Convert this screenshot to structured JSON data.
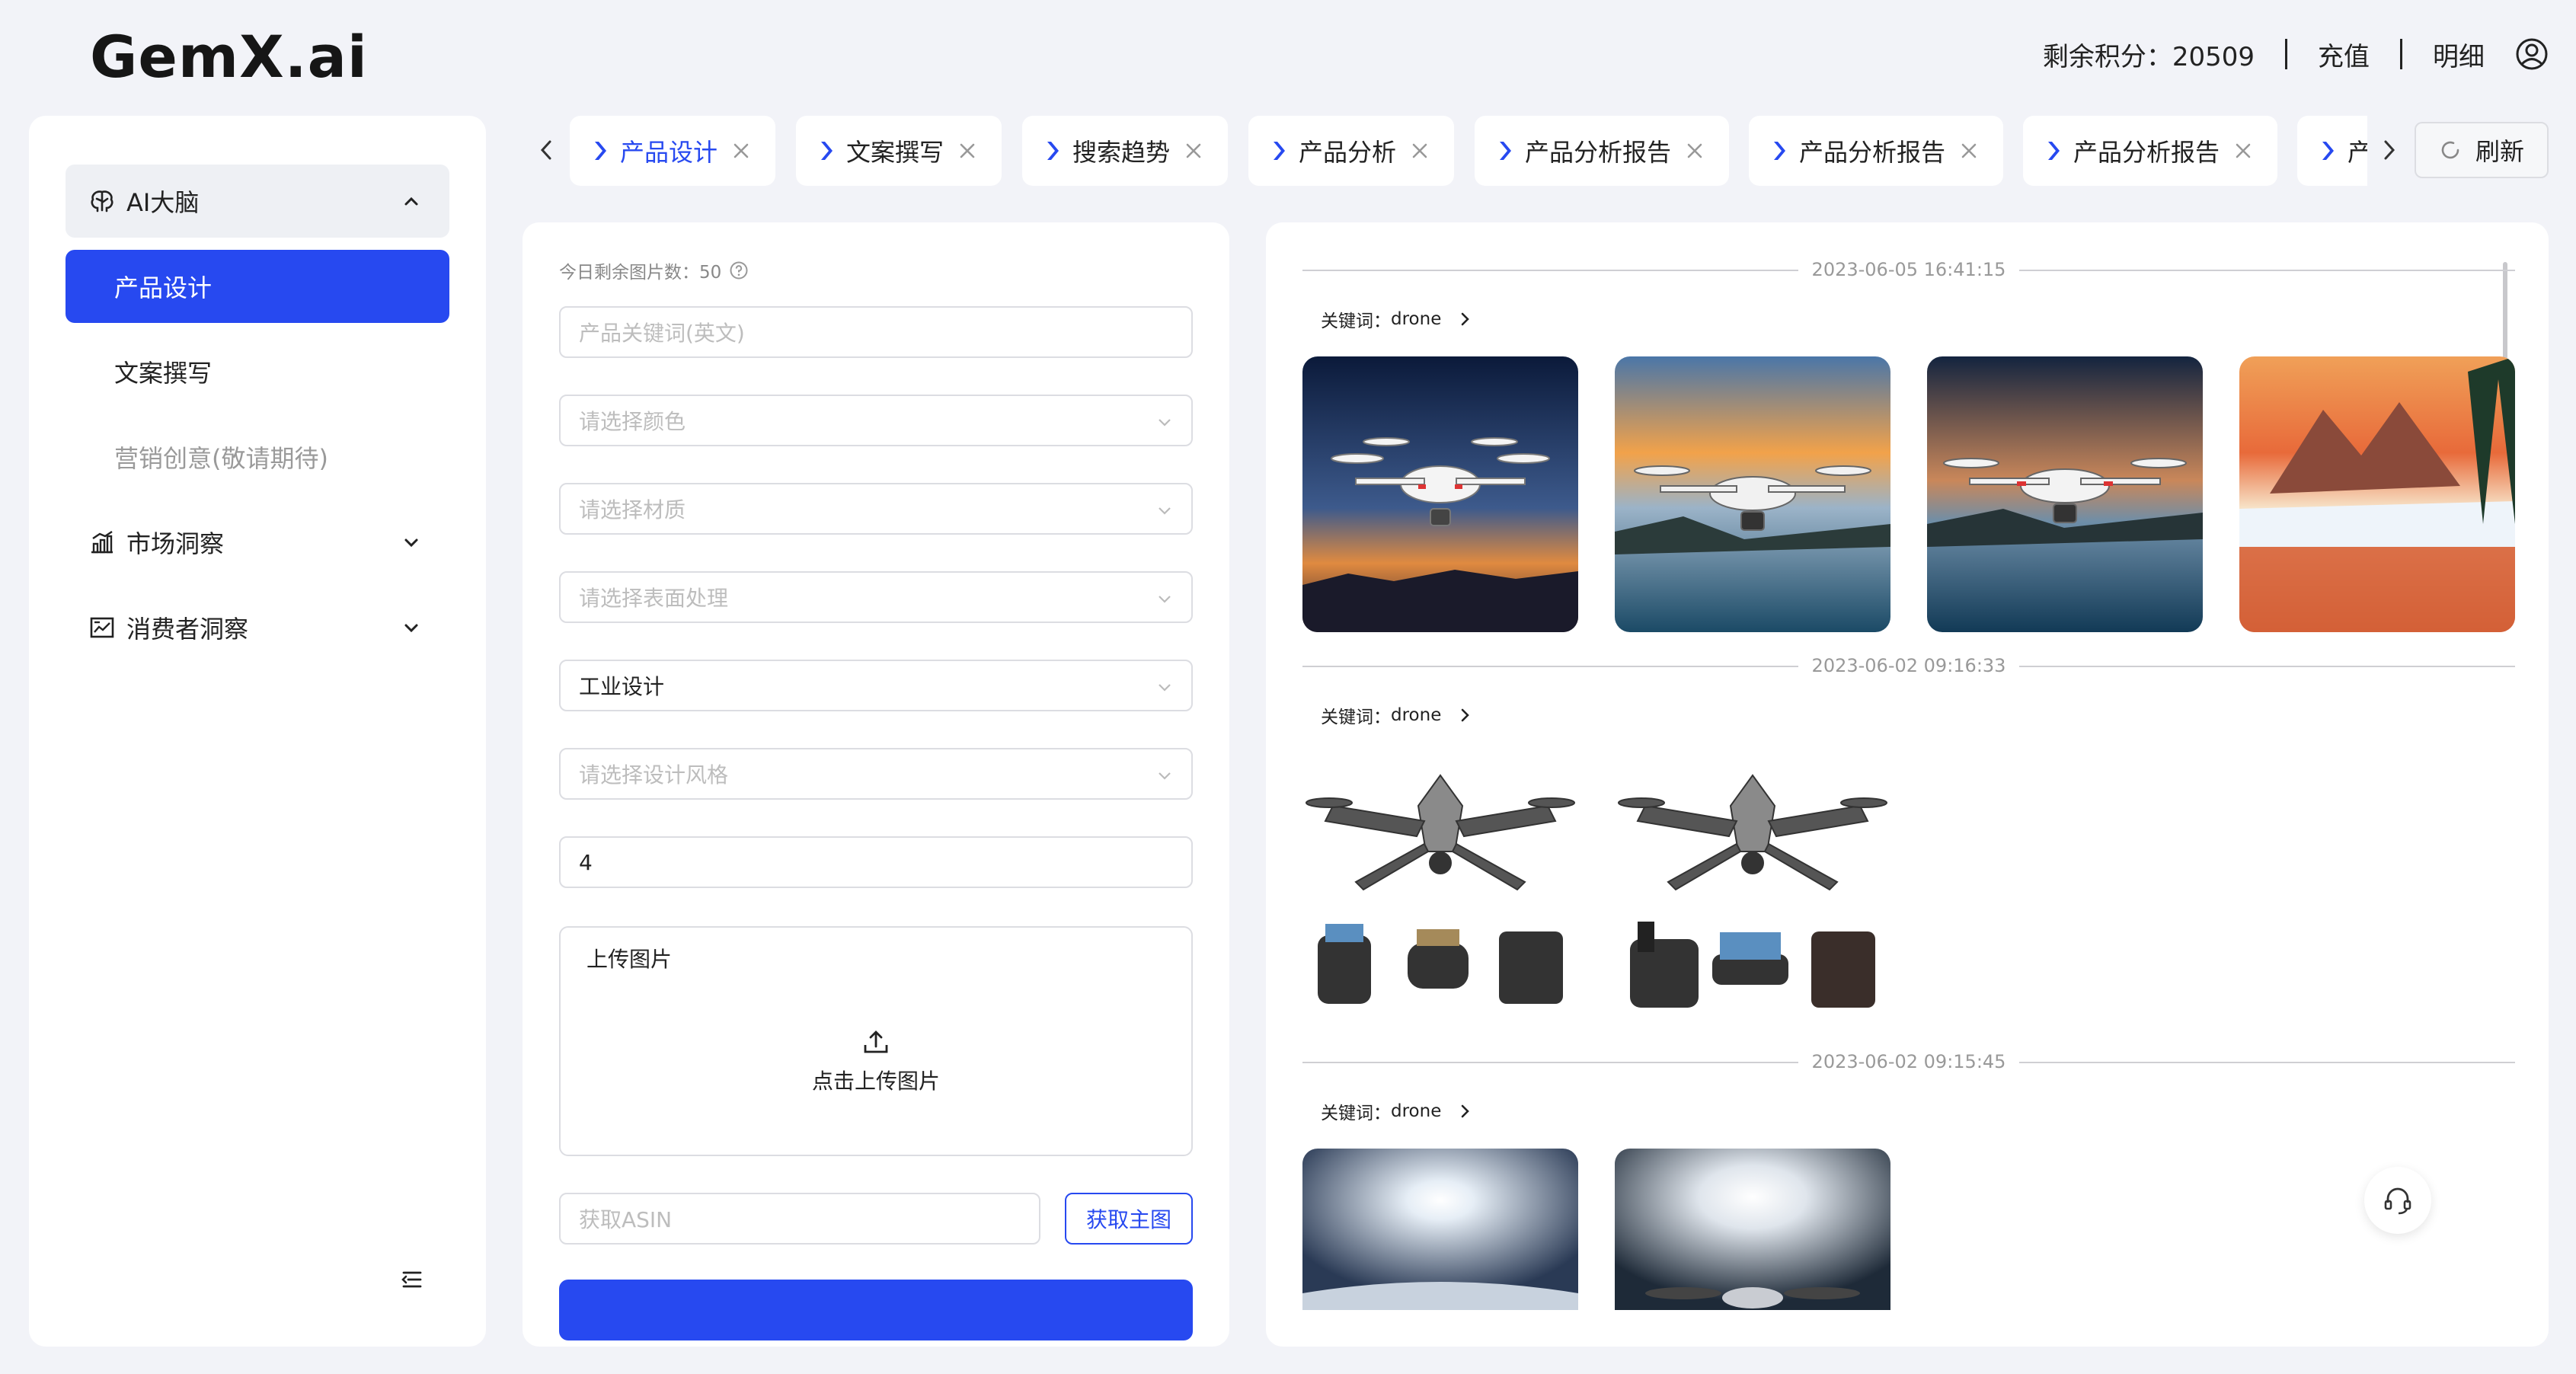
{
  "header": {
    "logo_text": "GemX.ai",
    "credits_label": "剩余积分：20509",
    "recharge_label": "充值",
    "details_label": "明细",
    "user_icon": "user-circle-icon"
  },
  "sidebar": {
    "group_ai": {
      "label": "AI大脑",
      "icon": "brain-icon",
      "expanded": true
    },
    "items": [
      {
        "label": "产品设计",
        "active": true
      },
      {
        "label": "文案撰写",
        "active": false
      },
      {
        "label": "营销创意(敬请期待)",
        "disabled": true
      }
    ],
    "group_market": {
      "label": "市场洞察",
      "icon": "bar-chart-icon"
    },
    "group_consumer": {
      "label": "消费者洞察",
      "icon": "image-chart-icon"
    },
    "collapse_icon": "collapse-menu-icon"
  },
  "tabs": {
    "items": [
      {
        "label": "产品设计",
        "active": true
      },
      {
        "label": "文案撰写"
      },
      {
        "label": "搜索趋势"
      },
      {
        "label": "产品分析"
      },
      {
        "label": "产品分析报告"
      },
      {
        "label": "产品分析报告"
      },
      {
        "label": "产品分析报告"
      },
      {
        "label": "产"
      }
    ],
    "refresh_label": "刷新"
  },
  "form": {
    "remaining_label": "今日剩余图片数：50",
    "keyword_placeholder": "产品关键词(英文)",
    "color_placeholder": "请选择颜色",
    "material_placeholder": "请选择材质",
    "surface_placeholder": "请选择表面处理",
    "design_type_value": "工业设计",
    "style_placeholder": "请选择设计风格",
    "count_value": "4",
    "upload_label": "上传图片",
    "upload_action": "点击上传图片",
    "asin_placeholder": "获取ASIN",
    "asin_button": "获取主图"
  },
  "history": {
    "groups": [
      {
        "date": "2023-06-05 16:41:15",
        "keyword_label": "关键词：",
        "keyword": "drone"
      },
      {
        "date": "2023-06-02 09:16:33",
        "keyword_label": "关键词：",
        "keyword": "drone"
      },
      {
        "date": "2023-06-02 09:15:45",
        "keyword_label": "关键词：",
        "keyword": "drone"
      }
    ]
  },
  "colors": {
    "primary": "#2749f0",
    "background": "#f2f3f8",
    "panel": "#ffffff"
  }
}
